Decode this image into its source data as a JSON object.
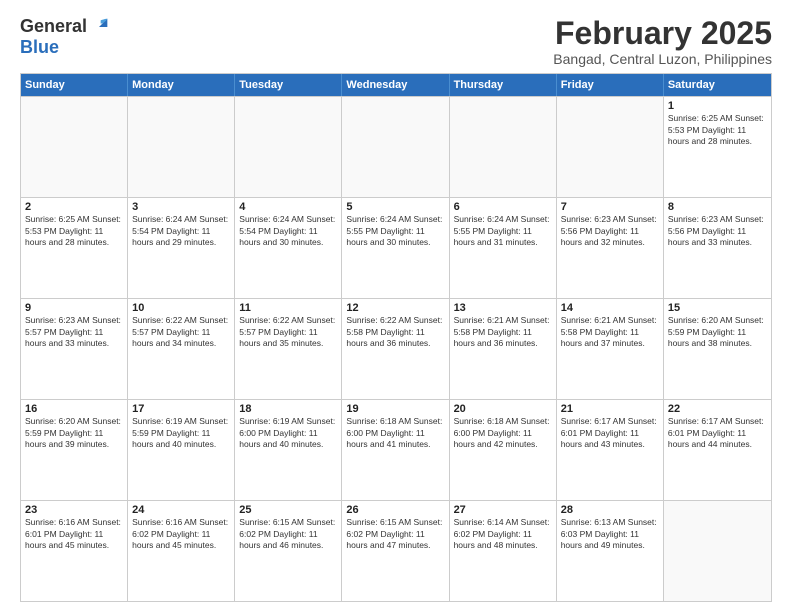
{
  "logo": {
    "general": "General",
    "blue": "Blue"
  },
  "title": "February 2025",
  "subtitle": "Bangad, Central Luzon, Philippines",
  "days_of_week": [
    "Sunday",
    "Monday",
    "Tuesday",
    "Wednesday",
    "Thursday",
    "Friday",
    "Saturday"
  ],
  "weeks": [
    [
      {
        "day": "",
        "info": ""
      },
      {
        "day": "",
        "info": ""
      },
      {
        "day": "",
        "info": ""
      },
      {
        "day": "",
        "info": ""
      },
      {
        "day": "",
        "info": ""
      },
      {
        "day": "",
        "info": ""
      },
      {
        "day": "1",
        "info": "Sunrise: 6:25 AM\nSunset: 5:53 PM\nDaylight: 11 hours and 28 minutes."
      }
    ],
    [
      {
        "day": "2",
        "info": "Sunrise: 6:25 AM\nSunset: 5:53 PM\nDaylight: 11 hours and 28 minutes."
      },
      {
        "day": "3",
        "info": "Sunrise: 6:24 AM\nSunset: 5:54 PM\nDaylight: 11 hours and 29 minutes."
      },
      {
        "day": "4",
        "info": "Sunrise: 6:24 AM\nSunset: 5:54 PM\nDaylight: 11 hours and 30 minutes."
      },
      {
        "day": "5",
        "info": "Sunrise: 6:24 AM\nSunset: 5:55 PM\nDaylight: 11 hours and 30 minutes."
      },
      {
        "day": "6",
        "info": "Sunrise: 6:24 AM\nSunset: 5:55 PM\nDaylight: 11 hours and 31 minutes."
      },
      {
        "day": "7",
        "info": "Sunrise: 6:23 AM\nSunset: 5:56 PM\nDaylight: 11 hours and 32 minutes."
      },
      {
        "day": "8",
        "info": "Sunrise: 6:23 AM\nSunset: 5:56 PM\nDaylight: 11 hours and 33 minutes."
      }
    ],
    [
      {
        "day": "9",
        "info": "Sunrise: 6:23 AM\nSunset: 5:57 PM\nDaylight: 11 hours and 33 minutes."
      },
      {
        "day": "10",
        "info": "Sunrise: 6:22 AM\nSunset: 5:57 PM\nDaylight: 11 hours and 34 minutes."
      },
      {
        "day": "11",
        "info": "Sunrise: 6:22 AM\nSunset: 5:57 PM\nDaylight: 11 hours and 35 minutes."
      },
      {
        "day": "12",
        "info": "Sunrise: 6:22 AM\nSunset: 5:58 PM\nDaylight: 11 hours and 36 minutes."
      },
      {
        "day": "13",
        "info": "Sunrise: 6:21 AM\nSunset: 5:58 PM\nDaylight: 11 hours and 36 minutes."
      },
      {
        "day": "14",
        "info": "Sunrise: 6:21 AM\nSunset: 5:58 PM\nDaylight: 11 hours and 37 minutes."
      },
      {
        "day": "15",
        "info": "Sunrise: 6:20 AM\nSunset: 5:59 PM\nDaylight: 11 hours and 38 minutes."
      }
    ],
    [
      {
        "day": "16",
        "info": "Sunrise: 6:20 AM\nSunset: 5:59 PM\nDaylight: 11 hours and 39 minutes."
      },
      {
        "day": "17",
        "info": "Sunrise: 6:19 AM\nSunset: 5:59 PM\nDaylight: 11 hours and 40 minutes."
      },
      {
        "day": "18",
        "info": "Sunrise: 6:19 AM\nSunset: 6:00 PM\nDaylight: 11 hours and 40 minutes."
      },
      {
        "day": "19",
        "info": "Sunrise: 6:18 AM\nSunset: 6:00 PM\nDaylight: 11 hours and 41 minutes."
      },
      {
        "day": "20",
        "info": "Sunrise: 6:18 AM\nSunset: 6:00 PM\nDaylight: 11 hours and 42 minutes."
      },
      {
        "day": "21",
        "info": "Sunrise: 6:17 AM\nSunset: 6:01 PM\nDaylight: 11 hours and 43 minutes."
      },
      {
        "day": "22",
        "info": "Sunrise: 6:17 AM\nSunset: 6:01 PM\nDaylight: 11 hours and 44 minutes."
      }
    ],
    [
      {
        "day": "23",
        "info": "Sunrise: 6:16 AM\nSunset: 6:01 PM\nDaylight: 11 hours and 45 minutes."
      },
      {
        "day": "24",
        "info": "Sunrise: 6:16 AM\nSunset: 6:02 PM\nDaylight: 11 hours and 45 minutes."
      },
      {
        "day": "25",
        "info": "Sunrise: 6:15 AM\nSunset: 6:02 PM\nDaylight: 11 hours and 46 minutes."
      },
      {
        "day": "26",
        "info": "Sunrise: 6:15 AM\nSunset: 6:02 PM\nDaylight: 11 hours and 47 minutes."
      },
      {
        "day": "27",
        "info": "Sunrise: 6:14 AM\nSunset: 6:02 PM\nDaylight: 11 hours and 48 minutes."
      },
      {
        "day": "28",
        "info": "Sunrise: 6:13 AM\nSunset: 6:03 PM\nDaylight: 11 hours and 49 minutes."
      },
      {
        "day": "",
        "info": ""
      }
    ]
  ]
}
